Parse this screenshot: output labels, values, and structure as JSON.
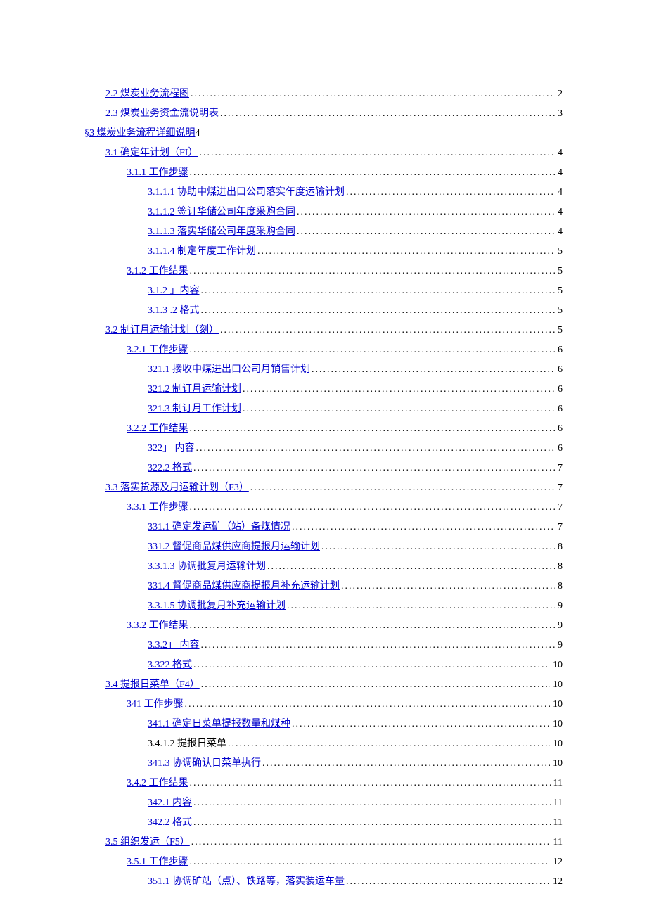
{
  "toc": [
    {
      "indent": 1,
      "num": "2.2",
      "title": "煤炭业务流程图",
      "page": "2",
      "link": true,
      "spaced": true
    },
    {
      "indent": 1,
      "num": "2.3",
      "title": "煤炭业务资金流说明表",
      "page": "3",
      "link": true,
      "spaced": true
    },
    {
      "indent": 0,
      "num": "§3",
      "title": "煤炭业务流程详细说明",
      "page": "4",
      "link": true,
      "spaced": false,
      "nodots": true
    },
    {
      "indent": 1,
      "num": "3.1",
      "title": "确定年计划（FI）",
      "page": "4",
      "link": true,
      "spaced": true
    },
    {
      "indent": 2,
      "num": "3.1.1",
      "title": "工作步骤",
      "page": "4",
      "link": true,
      "spaced": true
    },
    {
      "indent": 3,
      "num": "3.1.1.1",
      "title": "协助中煤进出口公司落实年度运输计划",
      "page": "4",
      "link": true,
      "spaced": false
    },
    {
      "indent": 3,
      "num": "3.1.1.2",
      "title": "签订华储公司年度采购合同",
      "page": "4",
      "link": true,
      "spaced": false
    },
    {
      "indent": 3,
      "num": "3.1.1.3",
      "title": "落实华储公司年度采购合同",
      "page": "4",
      "link": true,
      "spaced": false
    },
    {
      "indent": 3,
      "num": "3.1.1.4",
      "title": "制定年度工作计划",
      "page": "5",
      "link": true,
      "spaced": false
    },
    {
      "indent": 2,
      "num": "3.1.2",
      "title": "工作结果",
      "page": "5",
      "link": true,
      "spaced": true
    },
    {
      "indent": 3,
      "num": "3.1.2",
      "title": "」内容",
      "page": "5",
      "link": true,
      "spaced": false
    },
    {
      "indent": 3,
      "num": "3.1.3",
      "title": ".2 格式",
      "page": "5",
      "link": true,
      "spaced": false
    },
    {
      "indent": 1,
      "num": "3.2",
      "title": "制订月运输计划（刻）",
      "page": "5",
      "link": true,
      "spaced": true
    },
    {
      "indent": 2,
      "num": "3.2.1",
      "title": "工作步骤",
      "page": "6",
      "link": true,
      "spaced": true
    },
    {
      "indent": 3,
      "num": "321.1",
      "title": "接收中煤进出口公司月销售计划",
      "page": "6",
      "link": true,
      "spaced": true,
      "wide": true
    },
    {
      "indent": 3,
      "num": "321.2",
      "title": "制订月运输计划",
      "page": "6",
      "link": true,
      "spaced": true,
      "wide": true
    },
    {
      "indent": 3,
      "num": "321.3",
      "title": "制订月工作计划",
      "page": "6",
      "link": true,
      "spaced": true,
      "wide": true
    },
    {
      "indent": 2,
      "num": "3.2.2",
      "title": "工作结果",
      "page": "6",
      "link": true,
      "spaced": false
    },
    {
      "indent": 3,
      "num": "322」",
      "title": "内容",
      "page": "6",
      "link": true,
      "spaced": false
    },
    {
      "indent": 3,
      "num": "322.2",
      "title": "格式",
      "page": "7",
      "link": true,
      "spaced": false
    },
    {
      "indent": 1,
      "num": "3.3",
      "title": "落实货源及月运输计划（F3）",
      "page": "7",
      "link": true,
      "spaced": false
    },
    {
      "indent": 2,
      "num": "3.3.1",
      "title": "工作步骤",
      "page": "7",
      "link": true,
      "spaced": true
    },
    {
      "indent": 3,
      "num": "331.1",
      "title": "确定发运矿（站）备煤情况",
      "page": "7",
      "link": true,
      "spaced": false
    },
    {
      "indent": 3,
      "num": "331.2",
      "title": "督促商品煤供应商提报月运输计划",
      "page": "8",
      "link": true,
      "spaced": false
    },
    {
      "indent": 3,
      "num": "3.3.1.3",
      "title": "协调批复月运输计划",
      "page": "8",
      "link": true,
      "spaced": false
    },
    {
      "indent": 3,
      "num": "331.4",
      "title": "督促商品煤供应商提报月补充运输计划",
      "page": "8",
      "link": true,
      "spaced": false
    },
    {
      "indent": 3,
      "num": "3.3.1.5",
      "title": "协调批复月补充运输计划",
      "page": "9",
      "link": true,
      "spaced": false
    },
    {
      "indent": 2,
      "num": "3.3.2",
      "title": "工作结果",
      "page": "9",
      "link": true,
      "spaced": false
    },
    {
      "indent": 3,
      "num": "3.3.2」",
      "title": "内容",
      "page": "9",
      "link": true,
      "spaced": false
    },
    {
      "indent": 3,
      "num": "3.322",
      "title": "格式",
      "page": "10",
      "link": true,
      "spaced": false
    },
    {
      "indent": 1,
      "num": "3.4",
      "title": "提报日菜单（F4）",
      "page": "10",
      "link": true,
      "spaced": false
    },
    {
      "indent": 2,
      "num": "341",
      "title": "工作步骤",
      "page": "10",
      "link": true,
      "spaced": false
    },
    {
      "indent": 3,
      "num": "341.1",
      "title": "确定日菜单提报数量和煤种",
      "page": "10",
      "link": true,
      "spaced": false
    },
    {
      "indent": 3,
      "num": "3.4.1.2",
      "title": "提报日菜单",
      "page": "10",
      "link": false,
      "spaced": false
    },
    {
      "indent": 3,
      "num": "341.3",
      "title": "协调确认日菜单执行",
      "page": "10",
      "link": true,
      "spaced": false
    },
    {
      "indent": 2,
      "num": "3.4.2",
      "title": "工作结果",
      "page": "11",
      "link": true,
      "spaced": false
    },
    {
      "indent": 3,
      "num": "342.1",
      "title": "内容",
      "page": "11",
      "link": true,
      "spaced": true,
      "wide": true
    },
    {
      "indent": 3,
      "num": "342.2",
      "title": "格式",
      "page": "11",
      "link": true,
      "spaced": true,
      "wide": true
    },
    {
      "indent": 1,
      "num": "3.5",
      "title": "组织发运（F5）",
      "page": "11",
      "link": true,
      "spaced": false
    },
    {
      "indent": 2,
      "num": "3.5.1",
      "title": "工作步骤",
      "page": "12",
      "link": true,
      "spaced": true
    },
    {
      "indent": 3,
      "num": "351.1",
      "title": "协调矿站（点）、铁路等，落实装运车量",
      "page": "12",
      "link": true,
      "spaced": true,
      "wide": true
    }
  ]
}
